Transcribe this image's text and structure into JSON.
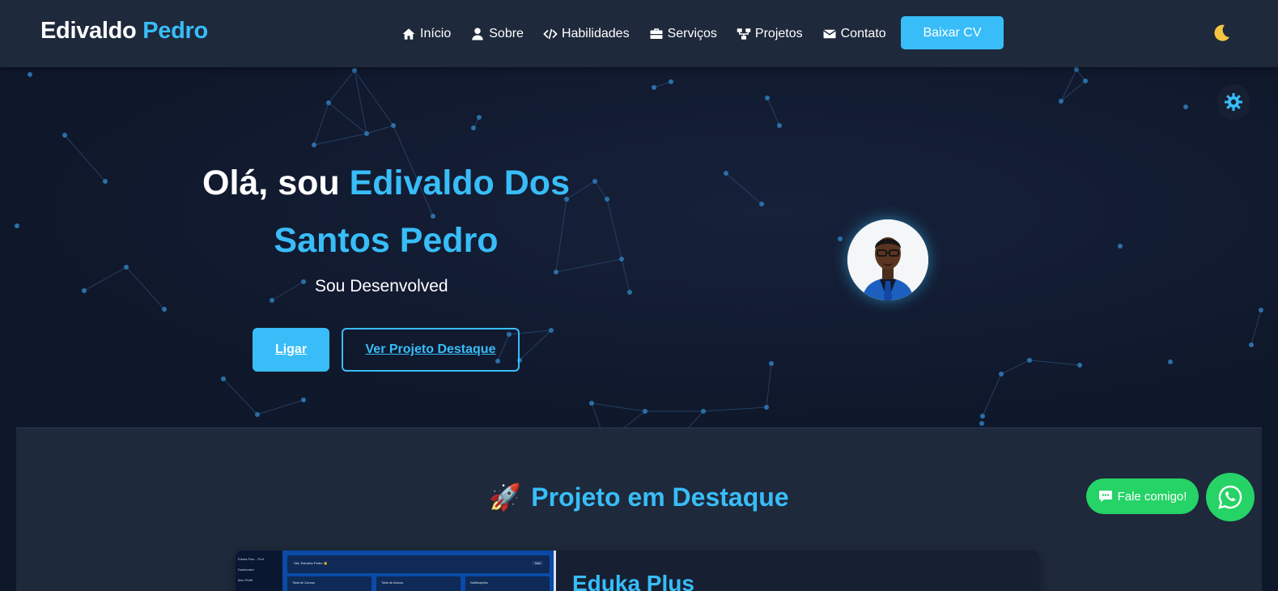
{
  "brand": {
    "first": "Edivaldo",
    "last": "Pedro"
  },
  "nav": {
    "items": [
      {
        "label": "Início",
        "icon": "home-icon"
      },
      {
        "label": "Sobre",
        "icon": "user-icon"
      },
      {
        "label": "Habilidades",
        "icon": "code-icon"
      },
      {
        "label": "Serviços",
        "icon": "briefcase-icon"
      },
      {
        "label": "Projetos",
        "icon": "sitemap-icon"
      },
      {
        "label": "Contato",
        "icon": "envelope-icon"
      }
    ],
    "cv_button": "Baixar CV",
    "theme_icon": "moon-icon"
  },
  "hero": {
    "greeting": "Olá, sou",
    "name_line1": "Edivaldo Dos",
    "name_line2": "Santos Pedro",
    "subtitle": "Sou Desenvolved",
    "call_button": "Ligar",
    "project_button": "Ver Projeto Destaque",
    "theme_toggle_icon": "gear-icon"
  },
  "featured": {
    "emoji": "🚀",
    "title": "Projeto em Destaque",
    "project_name": "Eduka Plus",
    "screenshot": {
      "sidebar_title": "Eduka Plus – Prof",
      "sidebar_items": [
        "Dashboard",
        "Meu Perfil"
      ],
      "header_text": "Olá, Edivaldo Pedro 👋",
      "header_button": "Sair",
      "cards": [
        "Total de Cursos",
        "Total de Alunos",
        "Notificações"
      ]
    }
  },
  "whatsapp": {
    "label": "Fale comigo!",
    "chat_icon": "chat-icon",
    "icon": "whatsapp-icon"
  },
  "colors": {
    "accent": "#38bdf8",
    "navbar": "#1e293b",
    "background": "#0f172a",
    "whatsapp": "#25d366"
  }
}
